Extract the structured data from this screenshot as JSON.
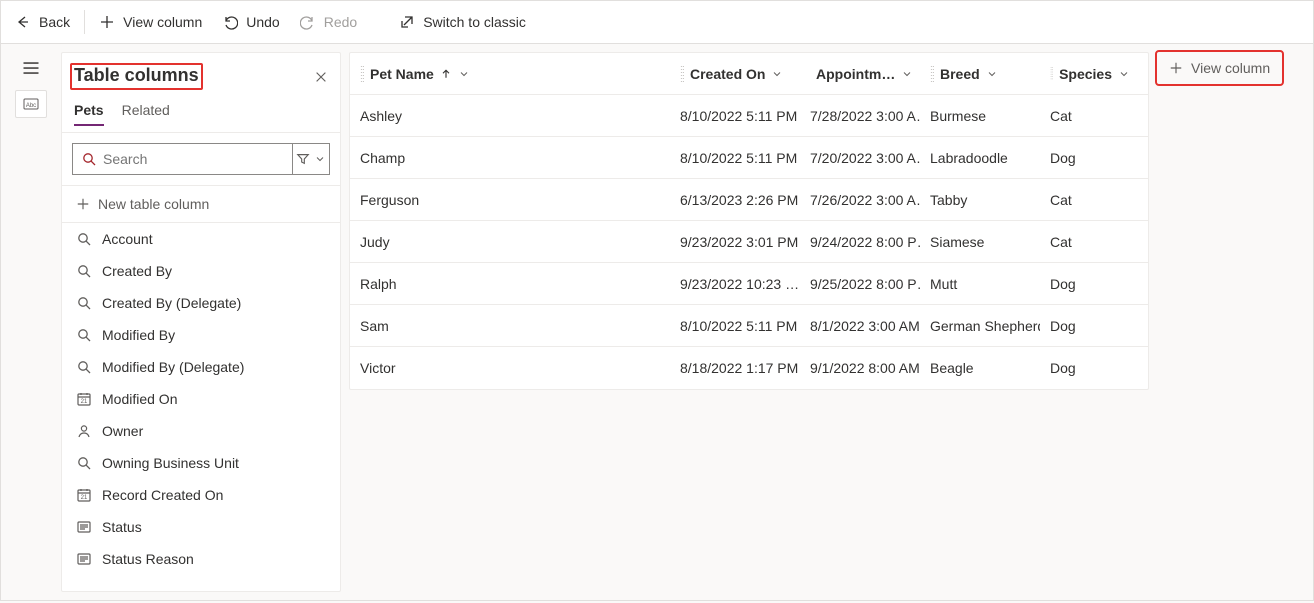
{
  "toolbar": {
    "back": "Back",
    "view_column": "View column",
    "undo": "Undo",
    "redo": "Redo",
    "switch_classic": "Switch to classic"
  },
  "panel": {
    "title": "Table columns",
    "tabs": {
      "pets": "Pets",
      "related": "Related"
    },
    "search_placeholder": "Search",
    "new_column": "New table column",
    "columns": [
      {
        "label": "Account",
        "icon": "lookup"
      },
      {
        "label": "Created By",
        "icon": "lookup"
      },
      {
        "label": "Created By (Delegate)",
        "icon": "lookup"
      },
      {
        "label": "Modified By",
        "icon": "lookup"
      },
      {
        "label": "Modified By (Delegate)",
        "icon": "lookup"
      },
      {
        "label": "Modified On",
        "icon": "date"
      },
      {
        "label": "Owner",
        "icon": "person"
      },
      {
        "label": "Owning Business Unit",
        "icon": "lookup"
      },
      {
        "label": "Record Created On",
        "icon": "date"
      },
      {
        "label": "Status",
        "icon": "choice"
      },
      {
        "label": "Status Reason",
        "icon": "choice"
      }
    ]
  },
  "grid": {
    "columns": {
      "pet_name": "Pet Name",
      "created_on": "Created On",
      "appointment": "Appointm…",
      "breed": "Breed",
      "species": "Species"
    },
    "rows": [
      {
        "pet": "Ashley",
        "created": "8/10/2022 5:11 PM",
        "appt": "7/28/2022 3:00 A…",
        "breed": "Burmese",
        "species": "Cat"
      },
      {
        "pet": "Champ",
        "created": "8/10/2022 5:11 PM",
        "appt": "7/20/2022 3:00 A…",
        "breed": "Labradoodle",
        "species": "Dog"
      },
      {
        "pet": "Ferguson",
        "created": "6/13/2023 2:26 PM",
        "appt": "7/26/2022 3:00 A…",
        "breed": "Tabby",
        "species": "Cat"
      },
      {
        "pet": "Judy",
        "created": "9/23/2022 3:01 PM",
        "appt": "9/24/2022 8:00 P…",
        "breed": "Siamese",
        "species": "Cat"
      },
      {
        "pet": "Ralph",
        "created": "9/23/2022 10:23 …",
        "appt": "9/25/2022 8:00 P…",
        "breed": "Mutt",
        "species": "Dog"
      },
      {
        "pet": "Sam",
        "created": "8/10/2022 5:11 PM",
        "appt": "8/1/2022 3:00 AM",
        "breed": "German Shepherd",
        "species": "Dog"
      },
      {
        "pet": "Victor",
        "created": "8/18/2022 1:17 PM",
        "appt": "9/1/2022 8:00 AM",
        "breed": "Beagle",
        "species": "Dog"
      }
    ]
  },
  "view_column_btn": "View column"
}
